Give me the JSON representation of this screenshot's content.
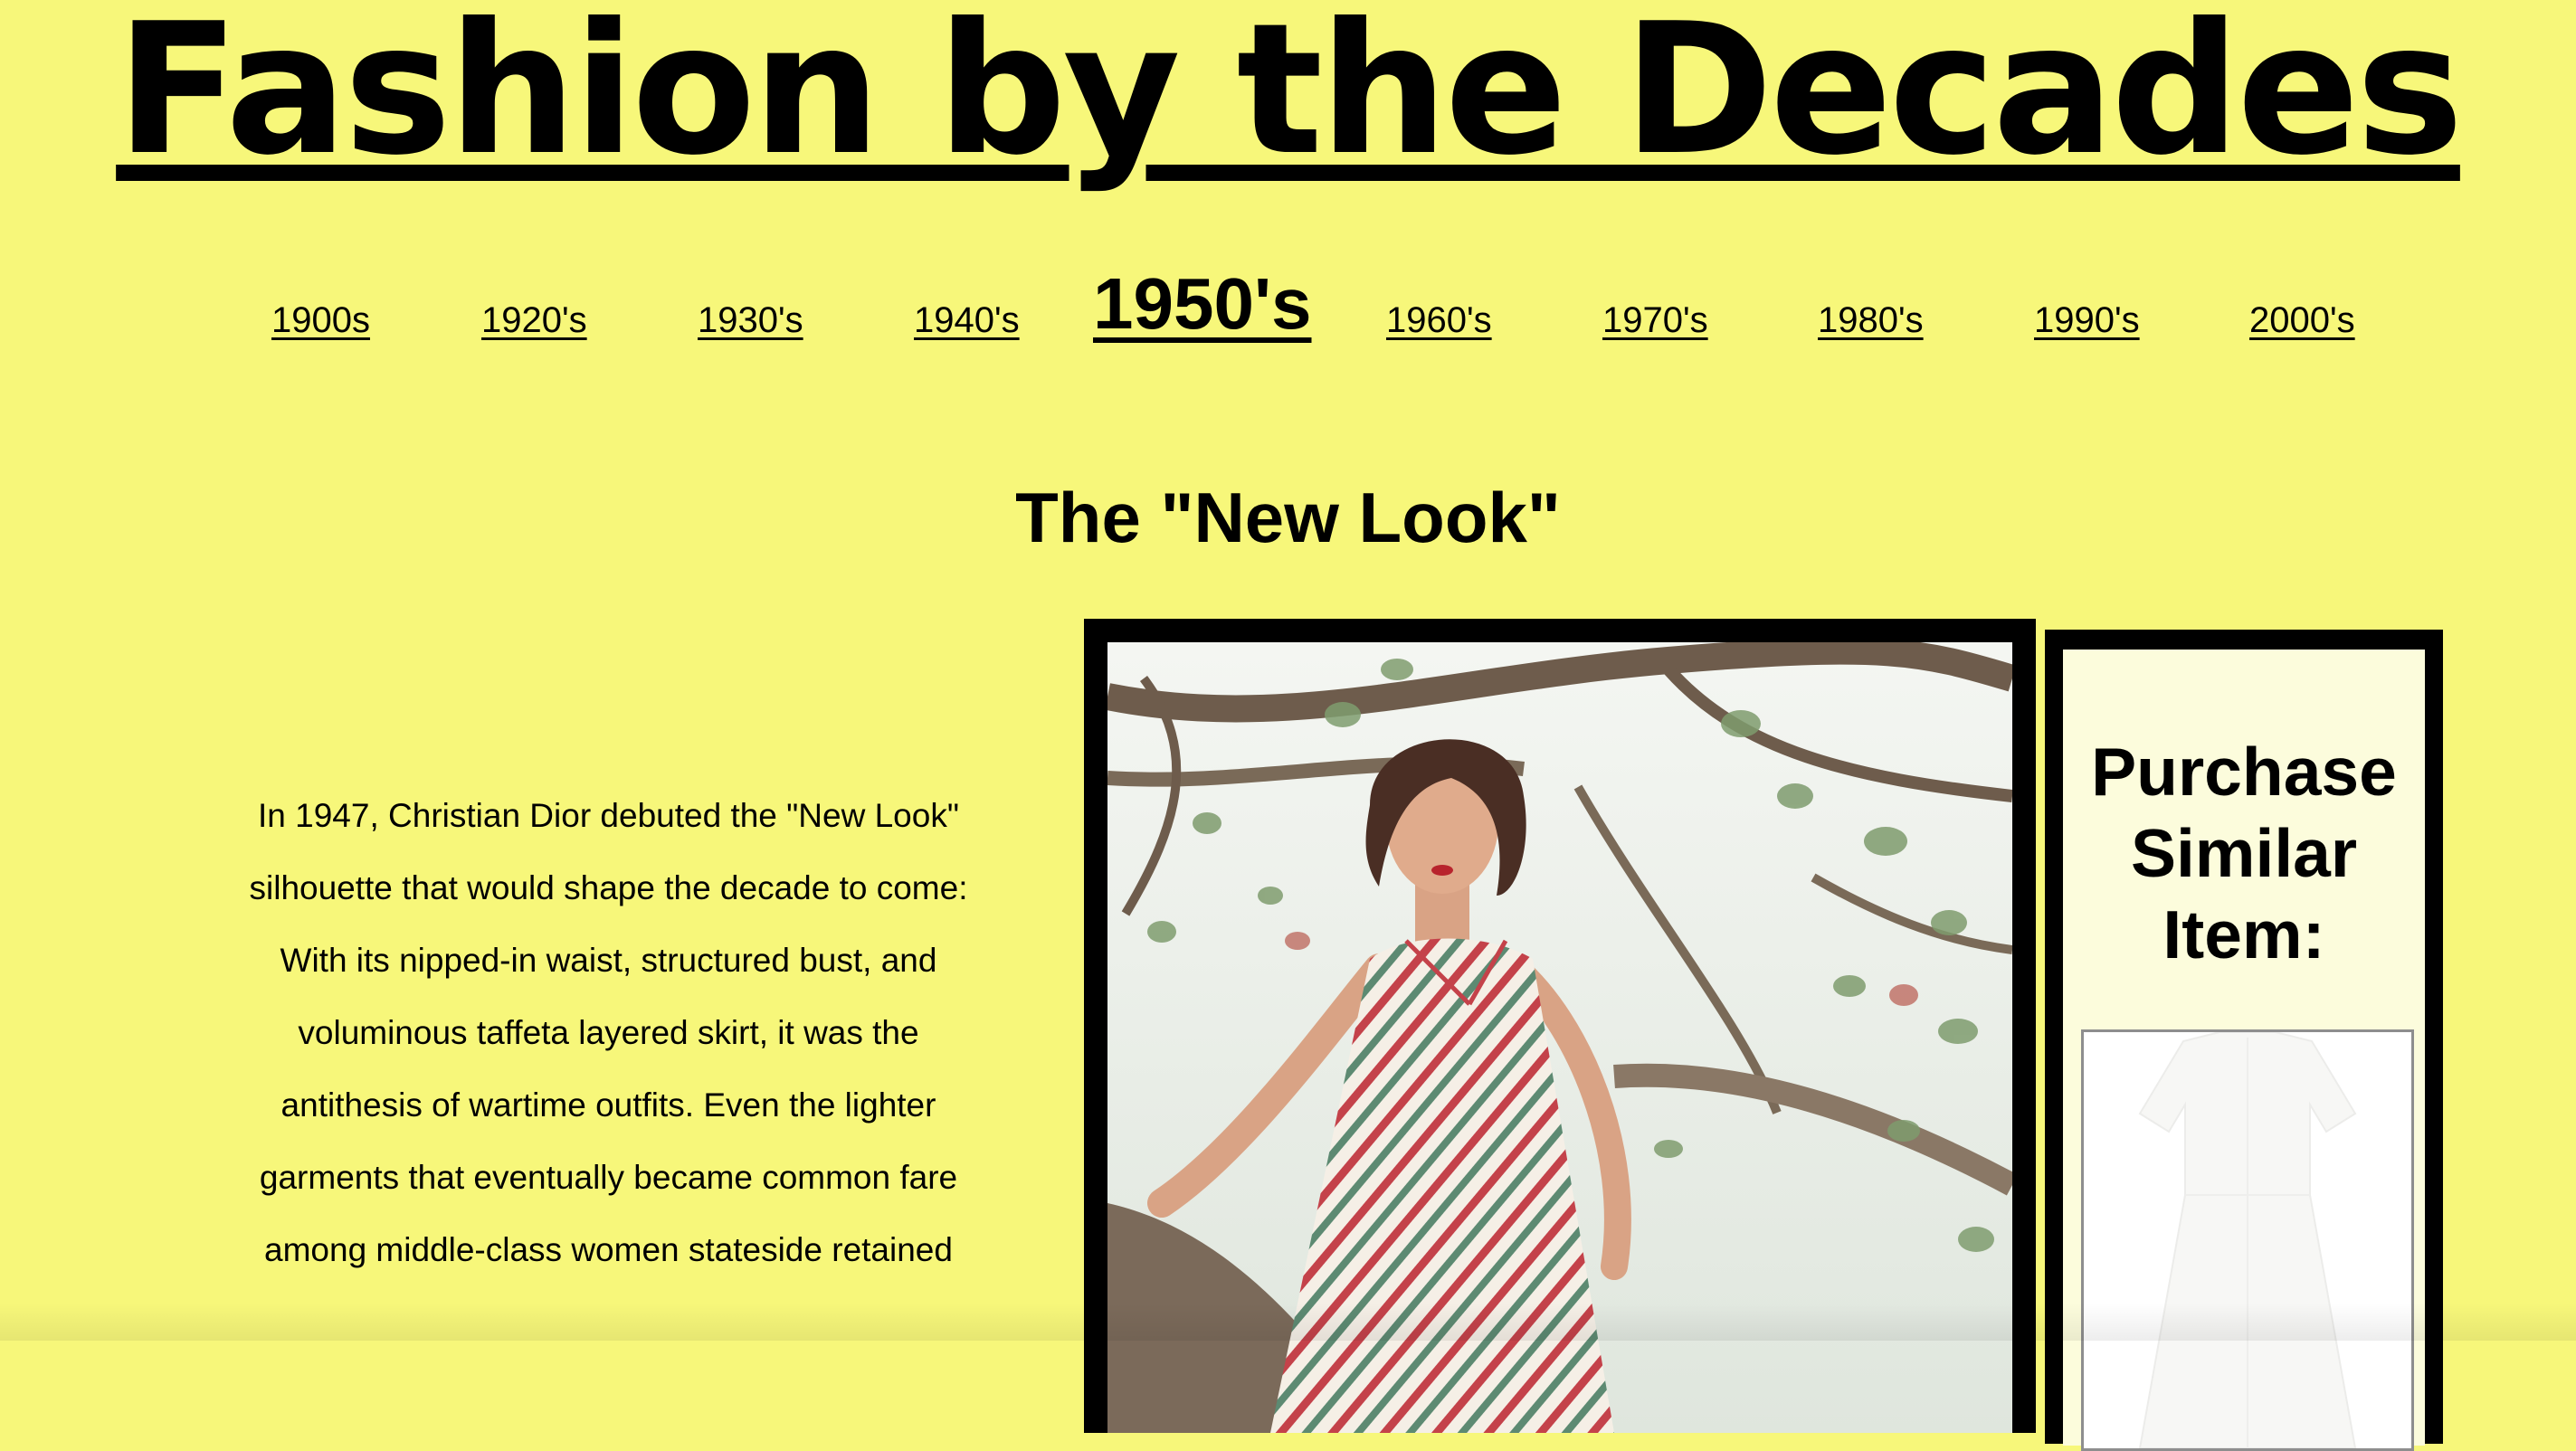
{
  "site": {
    "title": "Fashion by the Decades"
  },
  "nav": {
    "items": [
      {
        "label": "1900s",
        "active": false
      },
      {
        "label": "1920's",
        "active": false
      },
      {
        "label": "1930's",
        "active": false
      },
      {
        "label": "1940's",
        "active": false
      },
      {
        "label": "1950's",
        "active": true
      },
      {
        "label": "1960's",
        "active": false
      },
      {
        "label": "1970's",
        "active": false
      },
      {
        "label": "1980's",
        "active": false
      },
      {
        "label": "1990's",
        "active": false
      },
      {
        "label": "2000's",
        "active": false
      }
    ]
  },
  "section": {
    "heading": "The \"New Look\"",
    "body": "In 1947, Christian Dior debuted the \"New Look\" silhouette that would shape the decade to come: With its nipped-in waist, structured bust, and voluminous taffeta layered skirt, it was the antithesis of wartime outfits. Even the lighter garments that eventually became common fare among middle-class women stateside retained"
  },
  "purchase": {
    "heading": "Purchase Similar Item:"
  },
  "colors": {
    "page_background": "#f7f77a",
    "purchase_panel_background": "#fcfcdc",
    "frame_border": "#000000"
  }
}
